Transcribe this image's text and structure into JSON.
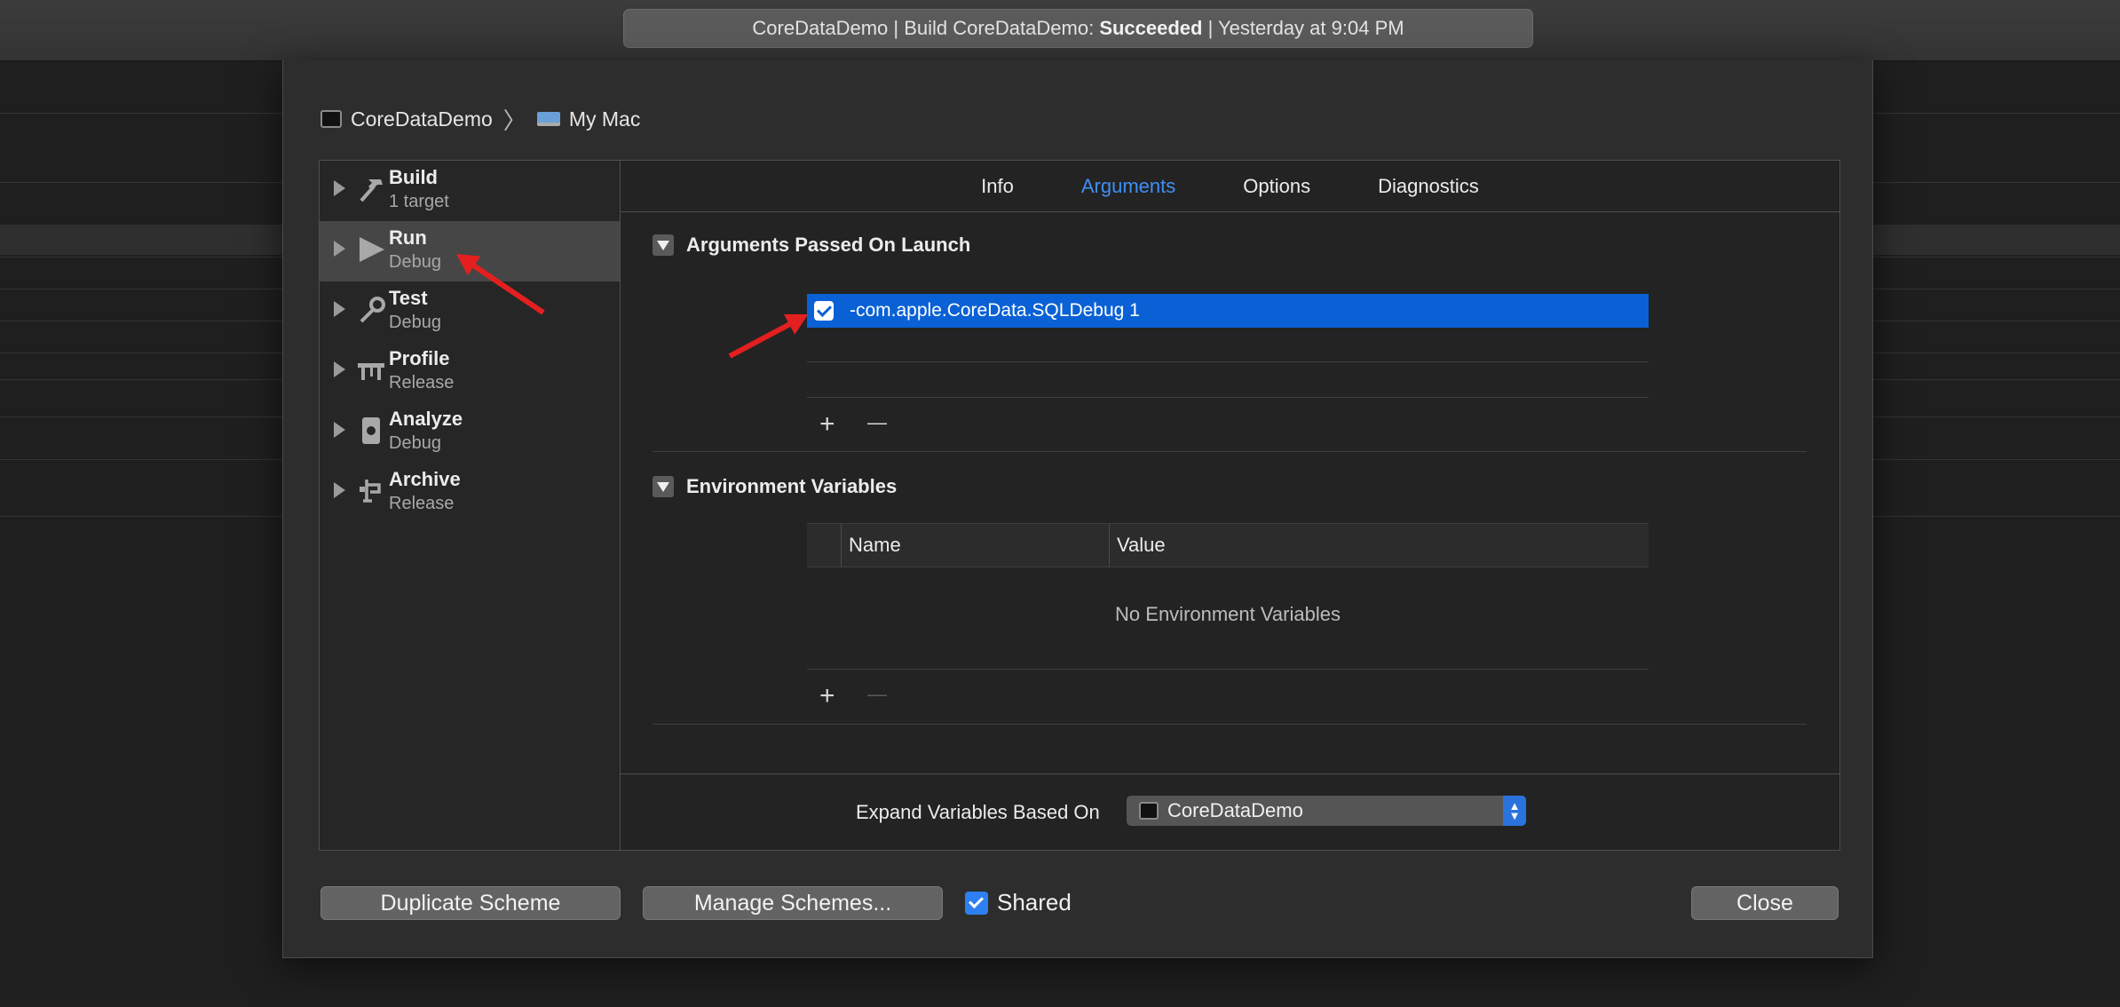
{
  "window": {
    "status": {
      "prefix": "CoreDataDemo | Build CoreDataDemo: ",
      "result": "Succeeded",
      "suffix": " | Yesterday at 9:04 PM"
    }
  },
  "breadcrumb": {
    "scheme": "CoreDataDemo",
    "destination": "My Mac"
  },
  "sidebar": {
    "items": [
      {
        "title": "Build",
        "subtitle": "1 target",
        "icon": "hammer-icon"
      },
      {
        "title": "Run",
        "subtitle": "Debug",
        "icon": "play-icon"
      },
      {
        "title": "Test",
        "subtitle": "Debug",
        "icon": "wrench-icon"
      },
      {
        "title": "Profile",
        "subtitle": "Release",
        "icon": "instruments-icon"
      },
      {
        "title": "Analyze",
        "subtitle": "Debug",
        "icon": "analyze-icon"
      },
      {
        "title": "Archive",
        "subtitle": "Release",
        "icon": "archive-icon"
      }
    ],
    "selected": "Run"
  },
  "tabs": {
    "items": [
      "Info",
      "Arguments",
      "Options",
      "Diagnostics"
    ],
    "active": "Arguments"
  },
  "arguments": {
    "title": "Arguments Passed On Launch",
    "rows": [
      {
        "checked": true,
        "value": "-com.apple.CoreData.SQLDebug 1"
      }
    ],
    "add": "+",
    "remove": "—"
  },
  "environment": {
    "title": "Environment Variables",
    "columns": [
      "Name",
      "Value"
    ],
    "empty": "No Environment Variables",
    "add": "+",
    "remove": "—"
  },
  "expand": {
    "label": "Expand Variables Based On",
    "value": "CoreDataDemo"
  },
  "footer": {
    "duplicate": "Duplicate Scheme",
    "manage": "Manage Schemes...",
    "shared_label": "Shared",
    "shared_checked": true,
    "close": "Close"
  },
  "colors": {
    "accent": "#3f8ff5",
    "selection": "#0a61d5",
    "annotation": "#e41f1f"
  }
}
